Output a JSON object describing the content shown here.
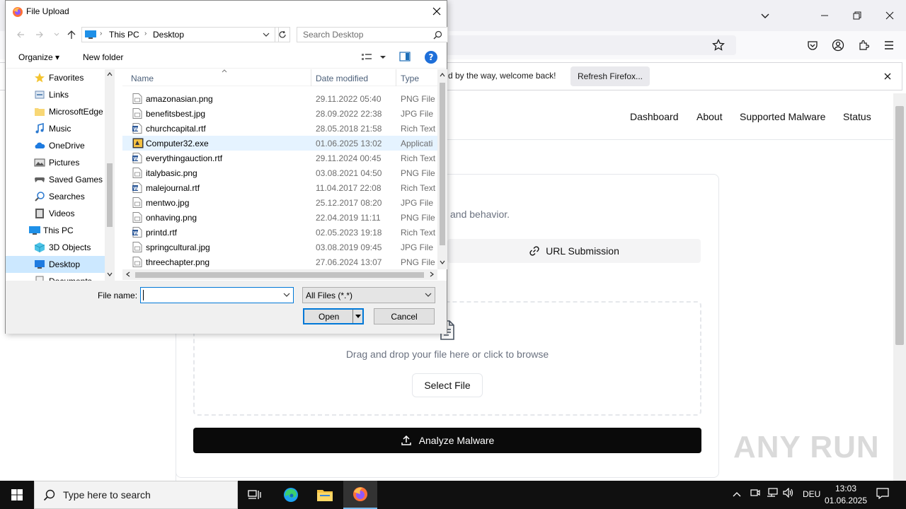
{
  "browser": {
    "notification_text": "d by the way, welcome back!",
    "refresh_button": "Refresh Firefox...",
    "nav": [
      "Dashboard",
      "About",
      "Supported Malware",
      "Status"
    ],
    "behavior_text": "and behavior.",
    "url_submission": "URL Submission",
    "drop_text": "Drag and drop your file here or click to browse",
    "select_file": "Select File",
    "analyze_button": "Analyze Malware",
    "watermark": "ANY RUN"
  },
  "dialog": {
    "title": "File Upload",
    "breadcrumb": [
      "This PC",
      "Desktop"
    ],
    "search_placeholder": "Search Desktop",
    "organize": "Organize",
    "new_folder": "New folder",
    "nav_items": [
      {
        "label": "Favorites",
        "icon": "star-icon"
      },
      {
        "label": "Links",
        "icon": "links-icon"
      },
      {
        "label": "MicrosoftEdge",
        "icon": "folder-icon"
      },
      {
        "label": "Music",
        "icon": "music-icon"
      },
      {
        "label": "OneDrive",
        "icon": "cloud-icon"
      },
      {
        "label": "Pictures",
        "icon": "pictures-icon"
      },
      {
        "label": "Saved Games",
        "icon": "games-icon"
      },
      {
        "label": "Searches",
        "icon": "search-icon"
      },
      {
        "label": "Videos",
        "icon": "videos-icon"
      },
      {
        "label": "This PC",
        "icon": "computer-icon"
      },
      {
        "label": "3D Objects",
        "icon": "cube-icon"
      },
      {
        "label": "Desktop",
        "icon": "desktop-icon"
      },
      {
        "label": "Documents",
        "icon": "documents-icon"
      }
    ],
    "columns": {
      "name": "Name",
      "date": "Date modified",
      "type": "Type"
    },
    "files": [
      {
        "name": "amazonasian.png",
        "date": "29.11.2022 05:40",
        "type": "PNG File",
        "icon": "image-file-icon"
      },
      {
        "name": "benefitsbest.jpg",
        "date": "28.09.2022 22:38",
        "type": "JPG File",
        "icon": "image-file-icon"
      },
      {
        "name": "churchcapital.rtf",
        "date": "28.05.2018 21:58",
        "type": "Rich Text",
        "icon": "word-file-icon"
      },
      {
        "name": "Computer32.exe",
        "date": "01.06.2025 13:02",
        "type": "Applicati",
        "icon": "exe-file-icon"
      },
      {
        "name": "everythingauction.rtf",
        "date": "29.11.2024 00:45",
        "type": "Rich Text",
        "icon": "word-file-icon"
      },
      {
        "name": "italybasic.png",
        "date": "03.08.2021 04:50",
        "type": "PNG File",
        "icon": "image-file-icon"
      },
      {
        "name": "malejournal.rtf",
        "date": "11.04.2017 22:08",
        "type": "Rich Text",
        "icon": "word-file-icon"
      },
      {
        "name": "mentwo.jpg",
        "date": "25.12.2017 08:20",
        "type": "JPG File",
        "icon": "image-file-icon"
      },
      {
        "name": "onhaving.png",
        "date": "22.04.2019 11:11",
        "type": "PNG File",
        "icon": "image-file-icon"
      },
      {
        "name": "printd.rtf",
        "date": "02.05.2023 19:18",
        "type": "Rich Text",
        "icon": "word-file-icon"
      },
      {
        "name": "springcultural.jpg",
        "date": "03.08.2019 09:45",
        "type": "JPG File",
        "icon": "image-file-icon"
      },
      {
        "name": "threechapter.png",
        "date": "27.06.2024 13:07",
        "type": "PNG File",
        "icon": "image-file-icon"
      }
    ],
    "file_name_label": "File name:",
    "file_name_value": "",
    "file_type": "All Files (*.*)",
    "open_button": "Open",
    "cancel_button": "Cancel"
  },
  "taskbar": {
    "search_placeholder": "Type here to search",
    "language": "DEU",
    "time": "13:03",
    "date": "01.06.2025"
  }
}
